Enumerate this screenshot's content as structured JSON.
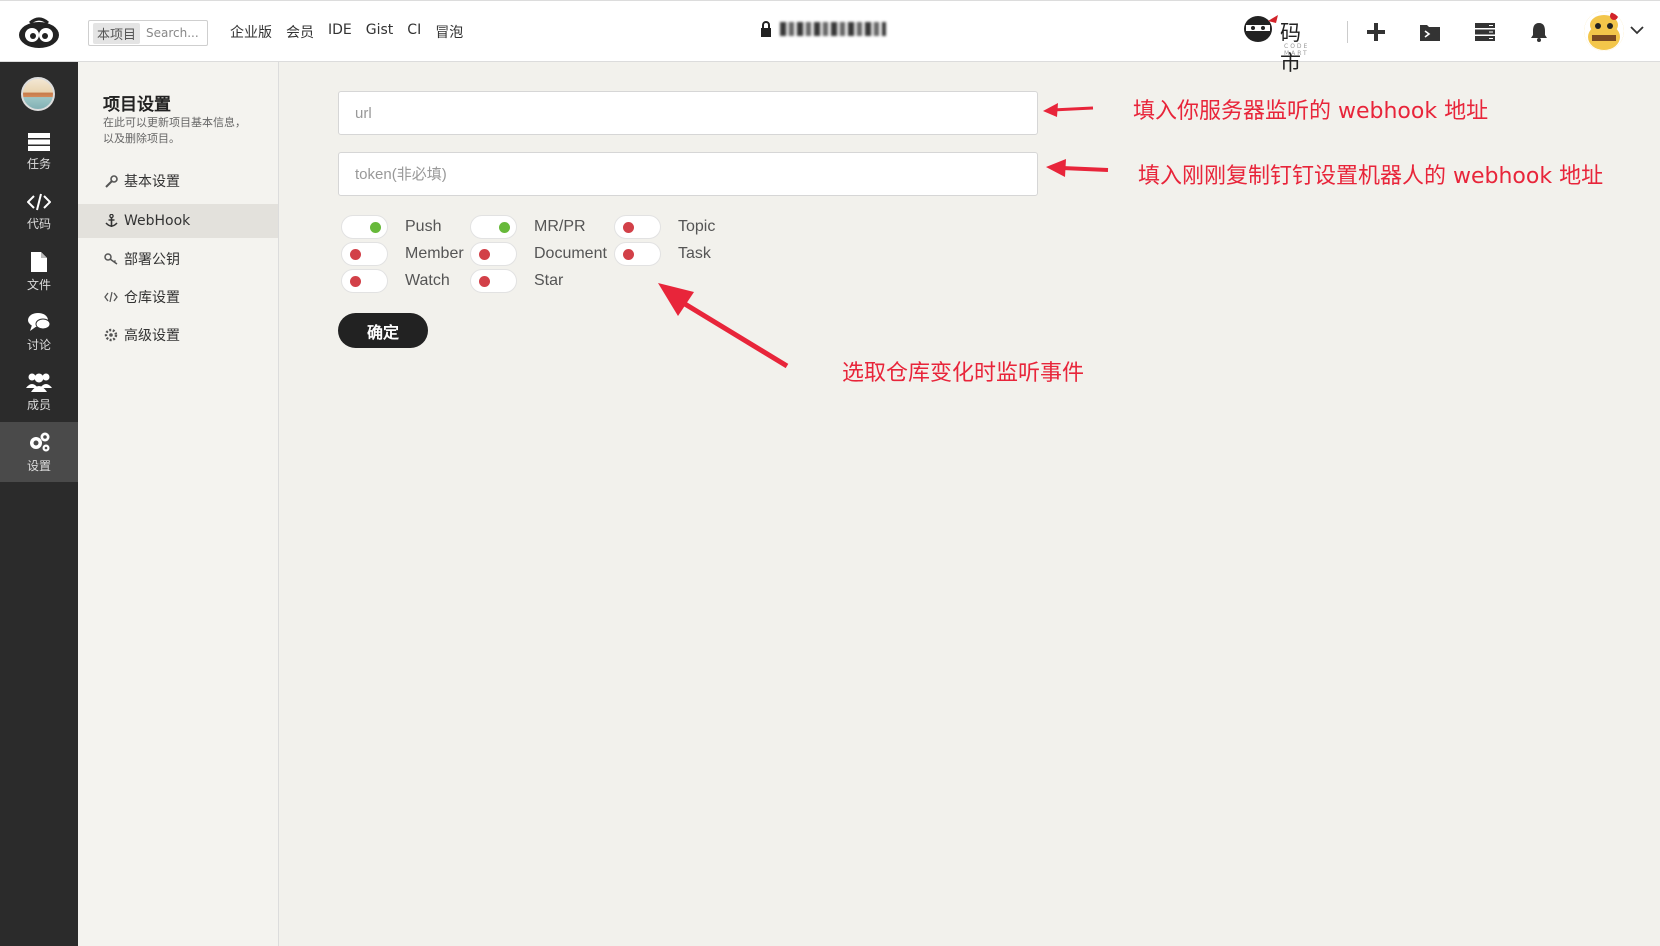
{
  "topbar": {
    "search_scope": "本项目",
    "search_placeholder": "Search...",
    "nav": [
      "企业版",
      "会员",
      "IDE",
      "Gist",
      "CI",
      "冒泡"
    ],
    "brand_text": "码 市",
    "brand_sub": "CODE MART"
  },
  "rail": {
    "items": [
      {
        "label": "任务",
        "icon": "tasks-icon"
      },
      {
        "label": "代码",
        "icon": "code-icon"
      },
      {
        "label": "文件",
        "icon": "file-icon"
      },
      {
        "label": "讨论",
        "icon": "discussion-icon"
      },
      {
        "label": "成员",
        "icon": "members-icon"
      },
      {
        "label": "设置",
        "icon": "settings-icon"
      }
    ],
    "active": "设置"
  },
  "settings": {
    "title": "项目设置",
    "description": "在此可以更新项目基本信息，以及删除项目。",
    "items": [
      {
        "label": "基本设置",
        "icon": "wrench-icon"
      },
      {
        "label": "WebHook",
        "icon": "anchor-icon"
      },
      {
        "label": "部署公钥",
        "icon": "key-icon"
      },
      {
        "label": "仓库设置",
        "icon": "code-icon"
      },
      {
        "label": "高级设置",
        "icon": "gears-icon"
      }
    ],
    "active": "WebHook"
  },
  "form": {
    "url_placeholder": "url",
    "url_value": "",
    "token_placeholder": "token(非必填)",
    "token_value": "",
    "events": [
      {
        "label": "Push",
        "enabled": true
      },
      {
        "label": "MR/PR",
        "enabled": true
      },
      {
        "label": "Topic",
        "enabled": false
      },
      {
        "label": "Member",
        "enabled": false
      },
      {
        "label": "Document",
        "enabled": false
      },
      {
        "label": "Task",
        "enabled": false
      },
      {
        "label": "Watch",
        "enabled": false
      },
      {
        "label": "Star",
        "enabled": false
      }
    ],
    "confirm_label": "确定"
  },
  "annotations": {
    "url_note": "填入你服务器监听的 webhook 地址",
    "token_note": "填入刚刚复制钉钉设置机器人的 webhook 地址",
    "events_note": "选取仓库变化时监听事件"
  },
  "colors": {
    "toggle_on": "#67b93a",
    "toggle_off": "#d24048",
    "annotation": "#e8253a",
    "rail_bg": "#2b2b2b"
  }
}
